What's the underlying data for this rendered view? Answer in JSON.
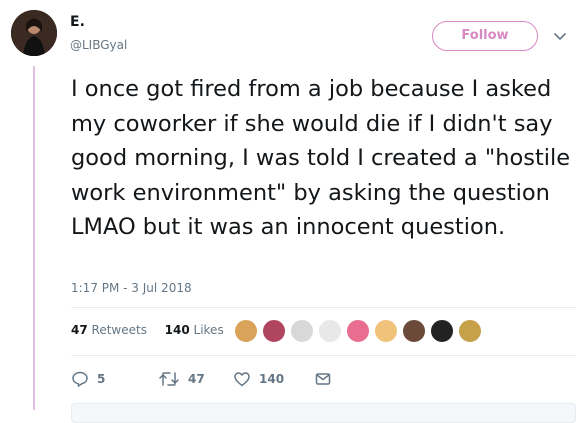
{
  "user": {
    "display_name": "E.",
    "handle": "@LIBGyal"
  },
  "follow_button": {
    "label": "Follow"
  },
  "tweet": {
    "text": "I once got fired from a job because I asked my coworker if she would die if I didn't say good morning, I was told I created a \"hostile work environment\" by asking the question LMAO but it was an innocent question.",
    "timestamp": "1:17 PM - 3 Jul 2018"
  },
  "stats": {
    "retweets_count": "47",
    "retweets_label": "Retweets",
    "likes_count": "140",
    "likes_label": "Likes"
  },
  "actions": {
    "reply_count": "5",
    "retweet_count": "47",
    "like_count": "140"
  },
  "colors": {
    "accent": "#d889c3",
    "thread_line": "#e1bfe0",
    "secondary_text": "#657786",
    "primary_text": "#14171a"
  }
}
